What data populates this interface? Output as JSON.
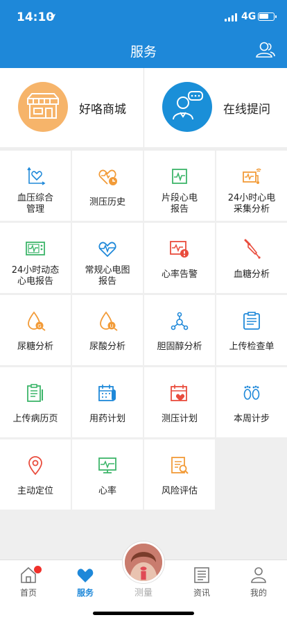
{
  "status": {
    "time": "14:10",
    "location_icon": "location-arrow-icon",
    "network": "4G",
    "battery_level": 0.6
  },
  "header": {
    "title": "服务",
    "user_icon": "users-icon"
  },
  "promo": [
    {
      "label": "好咯商城",
      "icon": "store-icon",
      "color": "#f6b46a"
    },
    {
      "label": "在线提问",
      "icon": "doctor-chat-icon",
      "color": "#1a8fd8"
    }
  ],
  "grid": [
    {
      "label": "血压综合\n管理",
      "lines": [
        "血压综合",
        "管理"
      ],
      "icon": "blood-pressure-heart-icon"
    },
    {
      "label": "测压历史",
      "lines": [
        "测压历史"
      ],
      "icon": "heart-history-icon"
    },
    {
      "label": "片段心电\n报告",
      "lines": [
        "片段心电",
        "报告"
      ],
      "icon": "ecg-segment-icon"
    },
    {
      "label": "24小时心电\n采集分析",
      "lines": [
        "24小时心电",
        "采集分析"
      ],
      "icon": "ecg-recorder-icon"
    },
    {
      "label": "24小时动态\n心电报告",
      "lines": [
        "24小时动态",
        "心电报告"
      ],
      "icon": "ecg-monitor-icon"
    },
    {
      "label": "常规心电图\n报告",
      "lines": [
        "常规心电图",
        "报告"
      ],
      "icon": "heart-pulse-icon"
    },
    {
      "label": "心率告警",
      "lines": [
        "心率告警"
      ],
      "icon": "heart-rate-alert-icon"
    },
    {
      "label": "血糖分析",
      "lines": [
        "血糖分析"
      ],
      "icon": "blood-sugar-dropper-icon"
    },
    {
      "label": "尿糖分析",
      "lines": [
        "尿糖分析"
      ],
      "icon": "urine-sugar-icon"
    },
    {
      "label": "尿酸分析",
      "lines": [
        "尿酸分析"
      ],
      "icon": "uric-acid-icon"
    },
    {
      "label": "胆固醇分析",
      "lines": [
        "胆固醇分析"
      ],
      "icon": "cholesterol-molecule-icon"
    },
    {
      "label": "上传检查单",
      "lines": [
        "上传检查单"
      ],
      "icon": "upload-checklist-icon"
    },
    {
      "label": "上传病历页",
      "lines": [
        "上传病历页"
      ],
      "icon": "medical-record-icon"
    },
    {
      "label": "用药计划",
      "lines": [
        "用药计划"
      ],
      "icon": "medication-calendar-icon"
    },
    {
      "label": "测压计划",
      "lines": [
        "测压计划"
      ],
      "icon": "pressure-calendar-icon"
    },
    {
      "label": "本周计步",
      "lines": [
        "本周计步"
      ],
      "icon": "footprints-icon"
    },
    {
      "label": "主动定位",
      "lines": [
        "主动定位"
      ],
      "icon": "location-pin-icon"
    },
    {
      "label": "心率",
      "lines": [
        "心率"
      ],
      "icon": "heart-rate-monitor-icon"
    },
    {
      "label": "风险评估",
      "lines": [
        "风险评估"
      ],
      "icon": "risk-assessment-icon"
    }
  ],
  "tabs": [
    {
      "label": "首页",
      "icon": "home-icon",
      "badge": true
    },
    {
      "label": "服务",
      "icon": "heart-icon",
      "active": true
    },
    {
      "label": "测量",
      "icon": "measure-avatar"
    },
    {
      "label": "资讯",
      "icon": "news-icon"
    },
    {
      "label": "我的",
      "icon": "profile-icon"
    }
  ],
  "colors": {
    "primary": "#1e88d9",
    "orange": "#f29b38",
    "green": "#3cb56a",
    "red": "#e94c3d"
  }
}
